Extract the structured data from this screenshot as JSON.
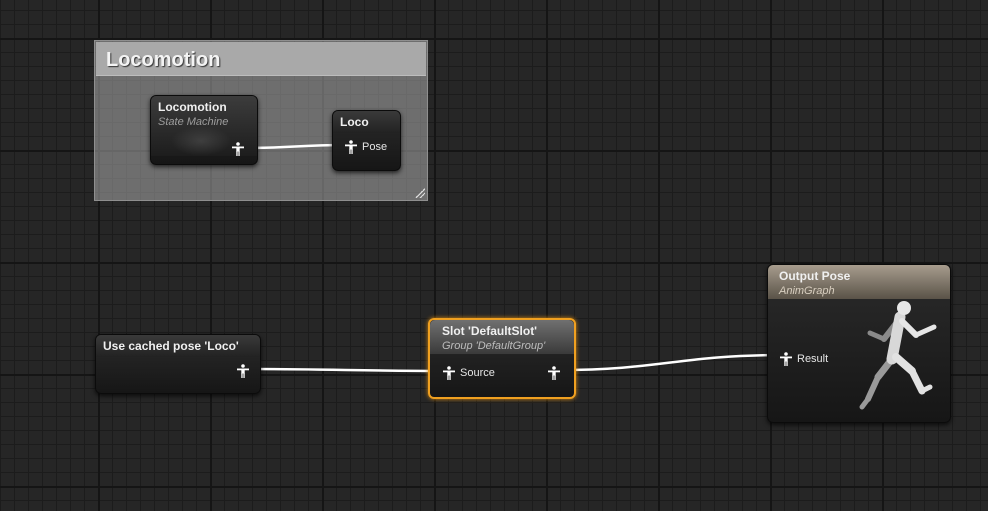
{
  "comment": {
    "title": "Locomotion"
  },
  "nodes": {
    "state_machine": {
      "title": "Locomotion",
      "subtitle": "State Machine"
    },
    "loco": {
      "title": "Loco",
      "pin": "Pose"
    },
    "cached_pose": {
      "title": "Use cached pose 'Loco'"
    },
    "slot": {
      "title": "Slot 'DefaultSlot'",
      "subtitle": "Group 'DefaultGroup'",
      "pin": "Source"
    },
    "output": {
      "title": "Output Pose",
      "subtitle": "AnimGraph",
      "pin": "Result"
    }
  },
  "colors": {
    "canvas": "#262626",
    "selection": "#f0a020",
    "wire": "#ffffff",
    "comment": "#a9a9a9"
  },
  "icons": [
    "pose-pin-icon",
    "mannequin-preview-icon",
    "resize-grip-icon"
  ]
}
